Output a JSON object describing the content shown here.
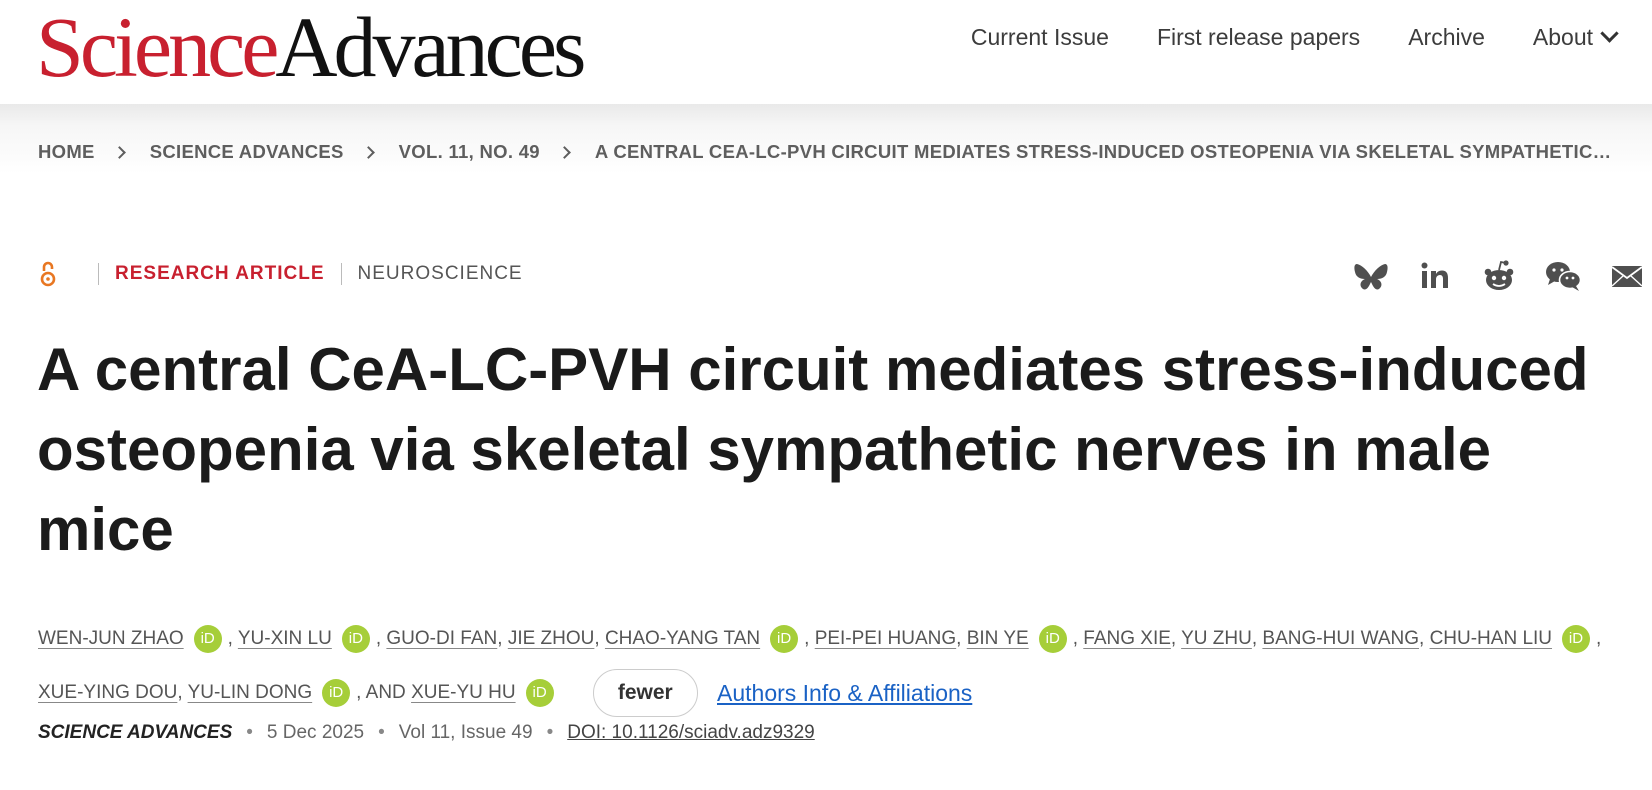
{
  "header": {
    "logo_part1": "Science",
    "logo_part2": "Advances",
    "nav": [
      "Current Issue",
      "First release papers",
      "Archive",
      "About"
    ]
  },
  "breadcrumb": [
    "HOME",
    "SCIENCE ADVANCES",
    "VOL. 11, NO. 49",
    "A CENTRAL CEA-LC-PVH CIRCUIT MEDIATES STRESS-INDUCED OSTEOPENIA VIA SKELETAL SYMPATHETIC…"
  ],
  "article_meta": {
    "type": "RESEARCH ARTICLE",
    "subject": "NEUROSCIENCE",
    "open_access_color": "#e87722"
  },
  "share_icons": [
    "bluesky-icon",
    "linkedin-icon",
    "reddit-icon",
    "wechat-icon",
    "email-icon"
  ],
  "title": "A central CeA-LC-PVH circuit mediates stress-induced osteopenia via skeletal sympathetic nerves in male mice",
  "authors": {
    "names": [
      "WEN-JUN ZHAO",
      "YU-XIN LU",
      "GUO-DI FAN",
      "JIE ZHOU",
      "CHAO-YANG TAN",
      "PEI-PEI HUANG",
      "BIN YE",
      "FANG XIE",
      "YU ZHU",
      "BANG-HUI WANG",
      "CHU-HAN LIU",
      "XUE-YING DOU",
      "YU-LIN DONG",
      "XUE-YU HU"
    ],
    "orcid_label": "iD",
    "and_label": ", AND ",
    "fewer_label": "fewer",
    "affiliations_label": "Authors Info & Affiliations"
  },
  "citation": {
    "journal": "SCIENCE ADVANCES",
    "date": "5 Dec 2025",
    "volume": "Vol 11, Issue 49",
    "doi": "DOI: 10.1126/sciadv.adz9329"
  },
  "colors": {
    "brand_red": "#c8202f",
    "link_blue": "#1a62c5",
    "orcid_green": "#a6ce39"
  }
}
